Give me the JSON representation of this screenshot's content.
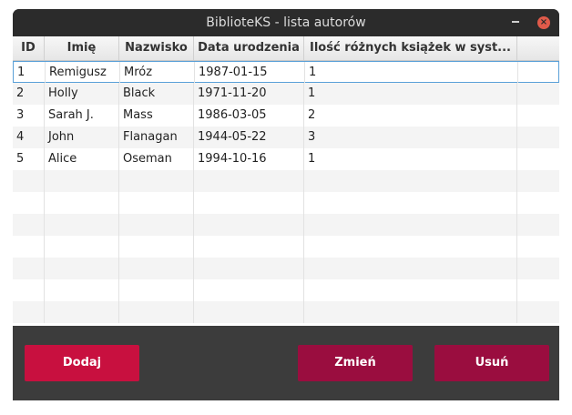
{
  "window": {
    "title": "BiblioteKS - lista autorów",
    "minimize_glyph": "",
    "close_glyph": "×"
  },
  "table": {
    "columns": [
      "ID",
      "Imię",
      "Nazwisko",
      "Data urodzenia",
      "Ilość różnych książek w syst..."
    ],
    "rows": [
      [
        "1",
        "Remigusz",
        "Mróz",
        "1987-01-15",
        "1"
      ],
      [
        "2",
        "Holly",
        "Black",
        "1971-11-20",
        "1"
      ],
      [
        "3",
        "Sarah J.",
        "Mass",
        "1986-03-05",
        "2"
      ],
      [
        "4",
        "John",
        "Flanagan",
        "1944-05-22",
        "3"
      ],
      [
        "5",
        "Alice",
        "Oseman",
        "1994-10-16",
        "1"
      ]
    ],
    "selected_row": 0
  },
  "buttons": {
    "add": "Dodaj",
    "edit": "Zmień",
    "delete": "Usuń"
  },
  "colors": {
    "add_button": "#c8103f",
    "edit_button": "#9a0d3f",
    "delete_button": "#9a0d3f",
    "selection_border": "#5aa0d8"
  }
}
